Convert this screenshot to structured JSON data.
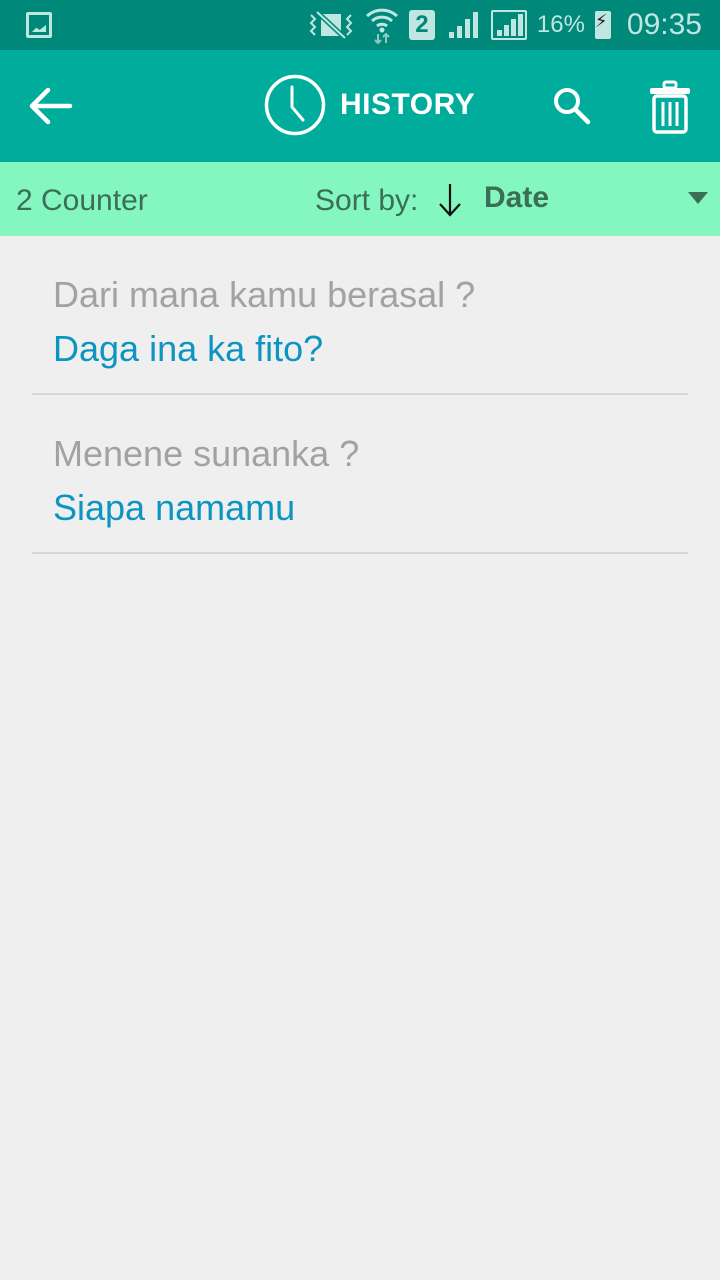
{
  "status_bar": {
    "time": "09:35",
    "battery_percent": "16%",
    "sim_slot": "2",
    "icons": [
      "gallery-icon",
      "vibrate-mute-icon",
      "wifi-icon",
      "sim-2-icon",
      "signal-icon",
      "signal-boxed-icon",
      "battery-charging-icon"
    ]
  },
  "app_bar": {
    "title": "HISTORY",
    "icons": {
      "back": "arrow-left-icon",
      "title": "clock-icon",
      "search": "search-icon",
      "delete": "trash-icon"
    }
  },
  "sort_bar": {
    "counter": "2 Counter",
    "sort_label": "Sort by:",
    "sort_direction": "descending",
    "sort_value": "Date"
  },
  "history": [
    {
      "source": "Dari mana kamu berasal ?",
      "translation": "Daga ina ka fito?"
    },
    {
      "source": "Menene sunanka ?",
      "translation": "Siapa namamu"
    }
  ],
  "colors": {
    "status_bar": "#00897b",
    "app_bar": "#00ad9c",
    "sort_bar": "#84f7c0",
    "source_text": "#a2a2a2",
    "translation_text": "#0d95c2",
    "background": "#efefef"
  }
}
